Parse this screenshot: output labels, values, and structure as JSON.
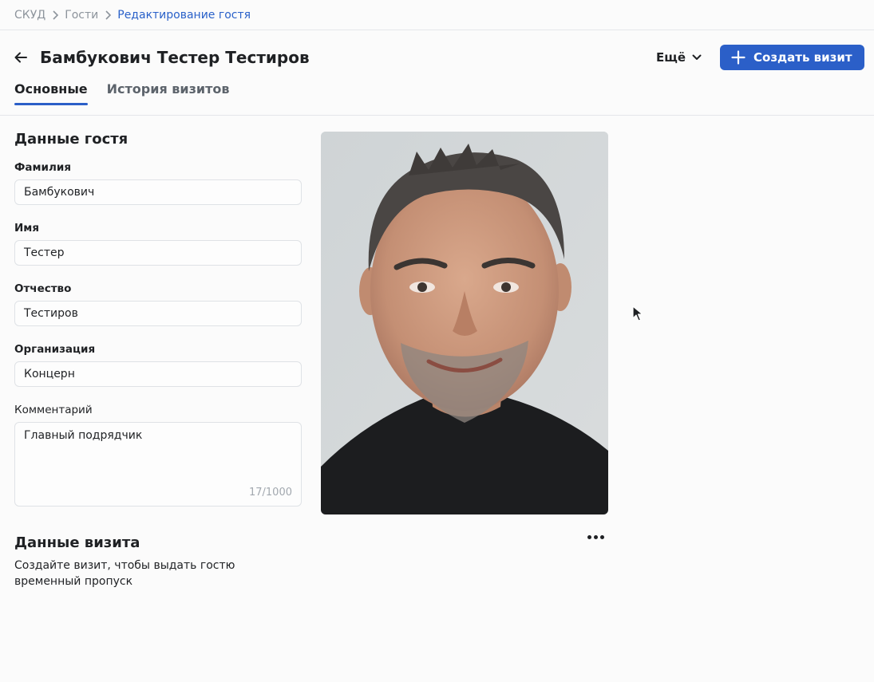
{
  "breadcrumb": {
    "items": [
      "СКУД",
      "Гости",
      "Редактирование гостя"
    ]
  },
  "header": {
    "title": "Бамбукович Тестер Тестиров",
    "more_label": "Ещё",
    "create_visit_label": "Создать визит"
  },
  "tabs": [
    {
      "label": "Основные",
      "active": true
    },
    {
      "label": "История визитов",
      "active": false
    }
  ],
  "guest": {
    "section_title": "Данные гостя",
    "fields": {
      "last_name": {
        "label": "Фамилия",
        "value": "Бамбукович"
      },
      "first_name": {
        "label": "Имя",
        "value": "Тестер"
      },
      "patronymic": {
        "label": "Отчество",
        "value": "Тестиров"
      },
      "organization": {
        "label": "Организация",
        "value": "Концерн"
      },
      "comment": {
        "label": "Комментарий",
        "value": "Главный подрядчик",
        "counter": "17/1000"
      }
    }
  },
  "visit": {
    "section_title": "Данные визита",
    "description": "Создайте визит, чтобы выдать гостю временный пропуск"
  },
  "icons": {
    "back": "arrow-left-icon",
    "more": "chevron-down-icon",
    "create": "plus-icon",
    "photo_menu": "more-horizontal-icon"
  },
  "colors": {
    "accent": "#2b5fc8",
    "text": "#1f2124",
    "muted": "#8d949c",
    "border": "#dfe2e6"
  }
}
